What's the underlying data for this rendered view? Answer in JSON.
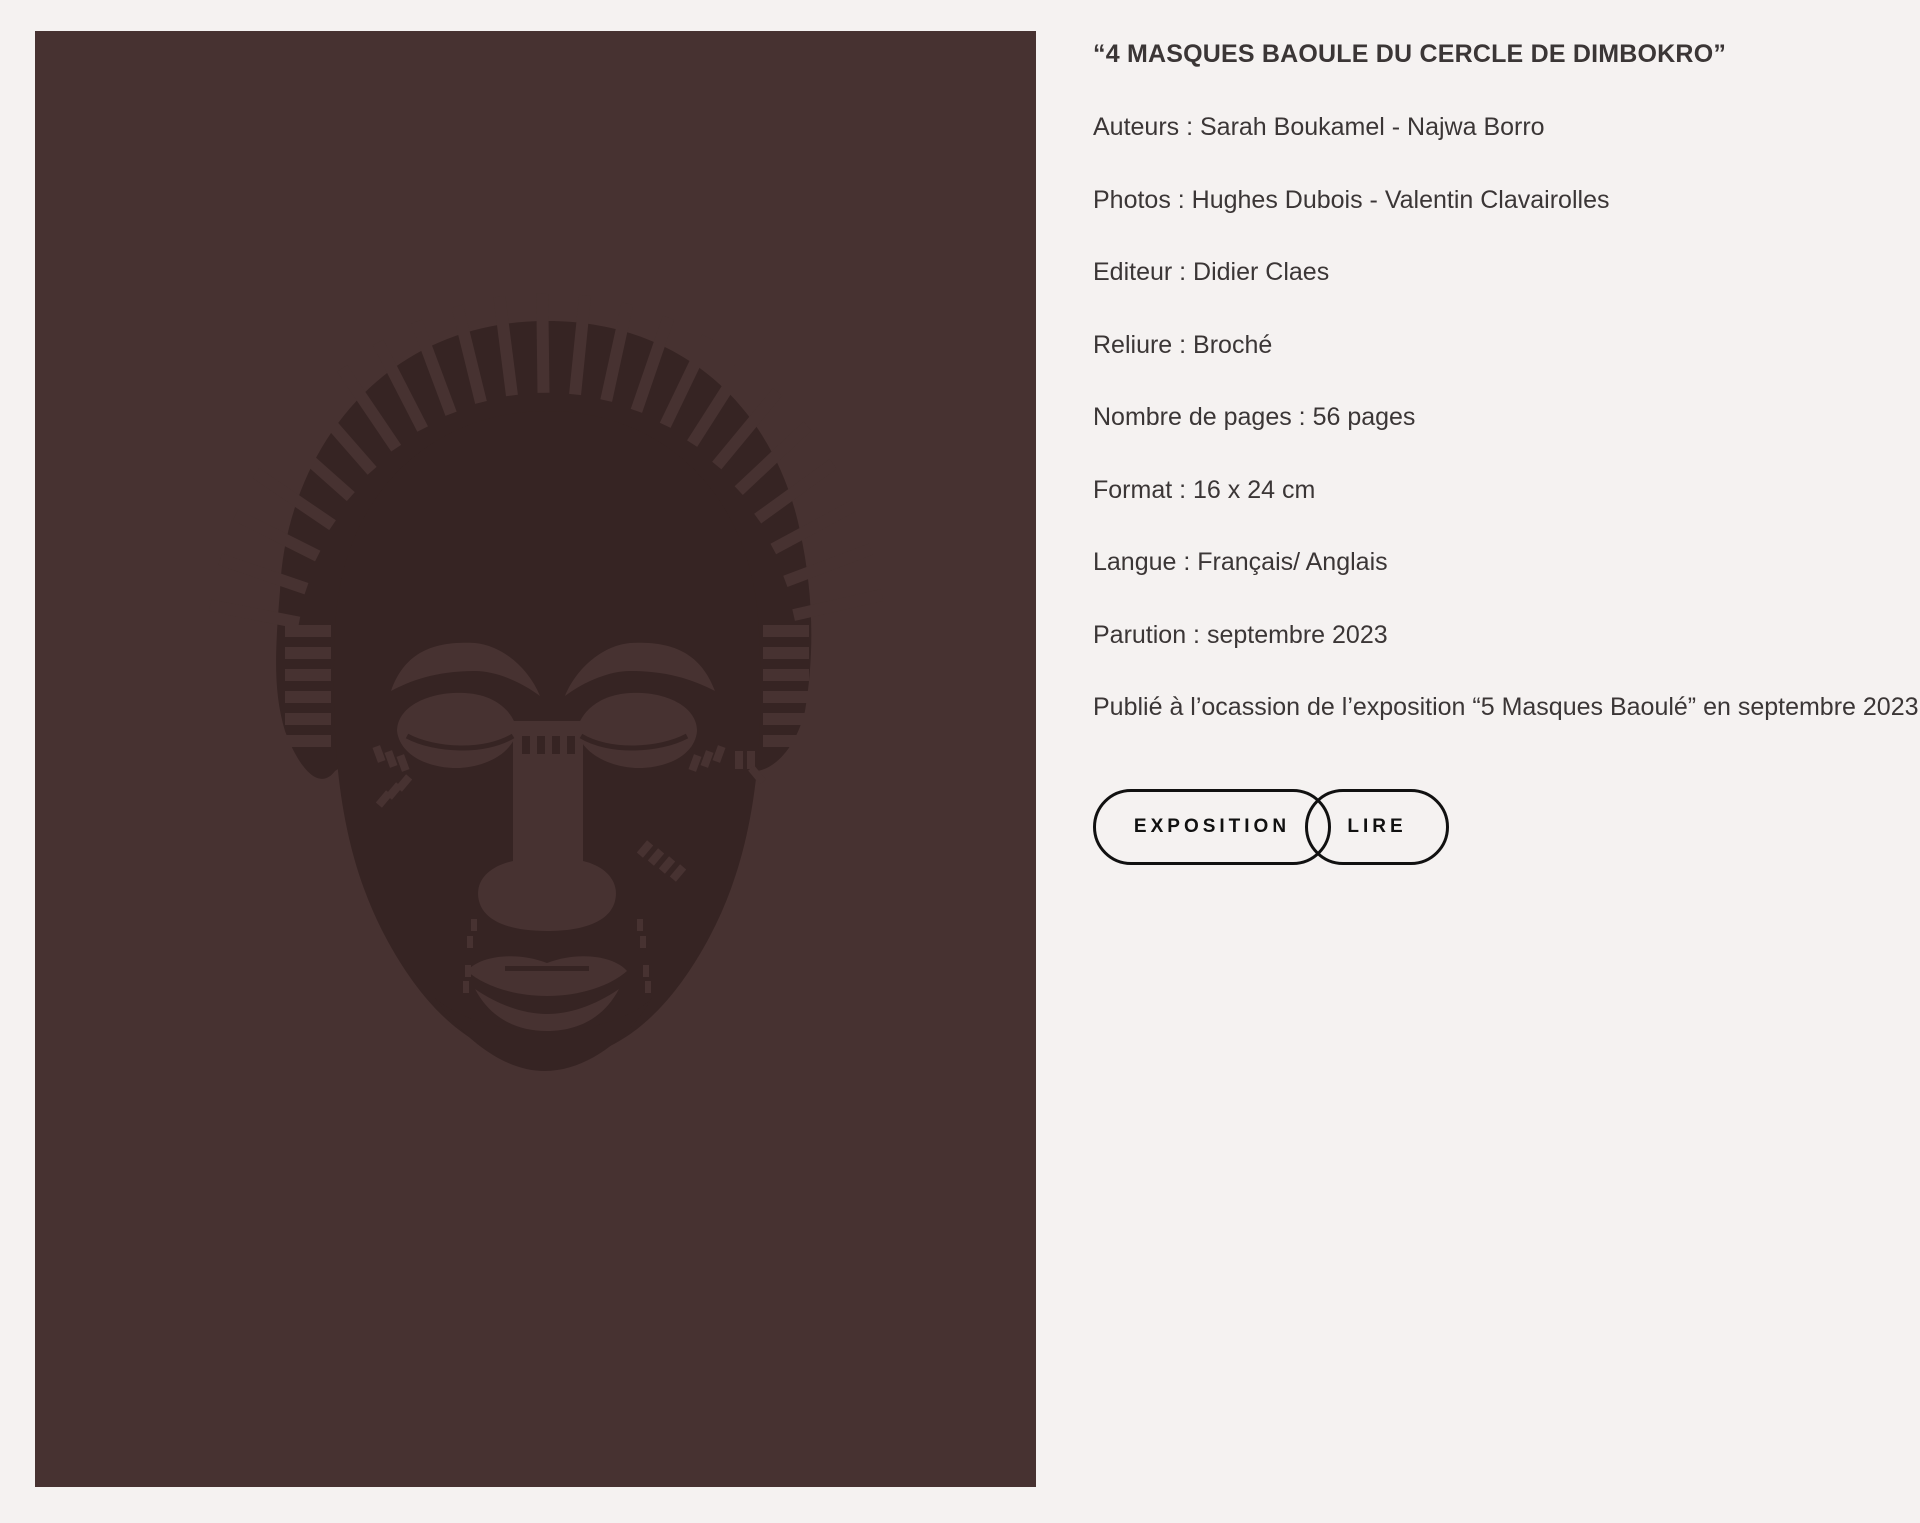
{
  "book": {
    "title": "“4 MASQUES BAOULE DU CERCLE DE DIMBOKRO”",
    "details": [
      "Auteurs : Sarah Boukamel - Najwa Borro",
      "Photos : Hughes Dubois - Valentin Clavairolles",
      "Editeur : Didier Claes",
      "Reliure : Broché",
      "Nombre de pages : 56 pages",
      "Format : 16 x 24 cm",
      "Langue : Français/ Anglais",
      "Parution : septembre 2023",
      "Publié à l’ocassion de l’exposition “5 Masques Baoulé” en septembre 2023"
    ]
  },
  "buttons": {
    "exposition_label": "EXPOSITION",
    "lire_label": "LIRE"
  },
  "cover": {
    "icon": "baule-mask-icon",
    "background_color": "#473231",
    "mask_color": "#362423"
  }
}
